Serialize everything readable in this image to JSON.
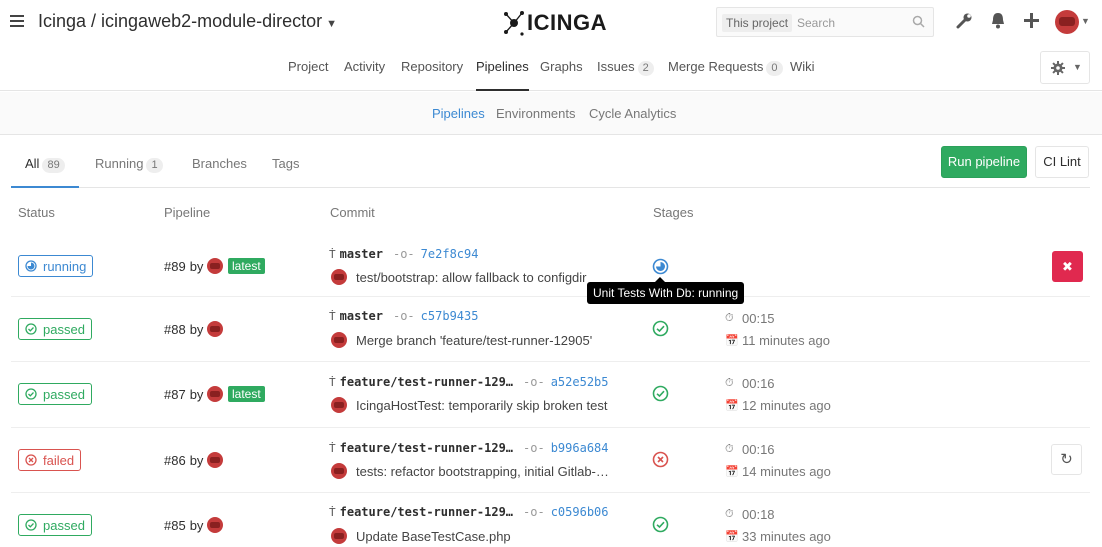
{
  "header": {
    "project_title": "Icinga / icingaweb2-module-director",
    "logo_text": "ICINGA",
    "search_scope": "This project",
    "search_placeholder": "Search"
  },
  "project_nav": [
    {
      "label": "Project"
    },
    {
      "label": "Activity"
    },
    {
      "label": "Repository"
    },
    {
      "label": "Pipelines",
      "active": true
    },
    {
      "label": "Graphs"
    },
    {
      "label": "Issues",
      "count": "2"
    },
    {
      "label": "Merge Requests",
      "count": "0"
    },
    {
      "label": "Wiki"
    }
  ],
  "sub_nav": [
    {
      "label": "Pipelines",
      "active": true
    },
    {
      "label": "Environments"
    },
    {
      "label": "Cycle Analytics"
    }
  ],
  "tabs": [
    {
      "label": "All",
      "count": "89",
      "active": true
    },
    {
      "label": "Running",
      "count": "1"
    },
    {
      "label": "Branches"
    },
    {
      "label": "Tags"
    }
  ],
  "actions": {
    "run_pipeline": "Run pipeline",
    "ci_lint": "CI Lint"
  },
  "table": {
    "headers": [
      "Status",
      "Pipeline",
      "Commit",
      "Stages"
    ],
    "rows": [
      {
        "status": "running",
        "pipeline": "#89",
        "by": "by",
        "latest": "latest",
        "ref": "master",
        "sha": "7e2f8c94",
        "message": "test/bootstrap: allow fallback to configdir",
        "stage": "running",
        "duration": "",
        "finished": "",
        "action": "cancel"
      },
      {
        "status": "passed",
        "pipeline": "#88",
        "by": "by",
        "latest": "",
        "ref": "master",
        "sha": "c57b9435",
        "message": "Merge branch 'feature/test-runner-12905'",
        "stage": "passed",
        "duration": "00:15",
        "finished": "11 minutes ago",
        "action": ""
      },
      {
        "status": "passed",
        "pipeline": "#87",
        "by": "by",
        "latest": "latest",
        "ref": "feature/test-runner-129…",
        "sha": "a52e52b5",
        "message": "IcingaHostTest: temporarily skip broken test",
        "stage": "passed",
        "duration": "00:16",
        "finished": "12 minutes ago",
        "action": ""
      },
      {
        "status": "failed",
        "pipeline": "#86",
        "by": "by",
        "latest": "",
        "ref": "feature/test-runner-129…",
        "sha": "b996a684",
        "message": "tests: refactor bootstrapping, initial Gitlab-…",
        "stage": "failed",
        "duration": "00:16",
        "finished": "14 minutes ago",
        "action": "retry"
      },
      {
        "status": "passed",
        "pipeline": "#85",
        "by": "by",
        "latest": "",
        "ref": "feature/test-runner-129…",
        "sha": "c0596b06",
        "message": "Update BaseTestCase.php",
        "stage": "passed",
        "duration": "00:18",
        "finished": "33 minutes ago",
        "action": ""
      }
    ]
  },
  "tooltip": "Unit Tests With Db: running",
  "colors": {
    "running": "#3c89d2",
    "passed": "#2faa60",
    "failed": "#d9534f",
    "cancel": "#e0294f"
  },
  "icons": {
    "hamburger": "hamburger-icon",
    "wrench": "wrench-icon",
    "bell": "bell-icon",
    "plus": "plus-icon",
    "gear": "gear-icon",
    "search": "search-icon",
    "clock": "timer-icon",
    "calendar": "calendar-icon",
    "branch": "branch-icon",
    "commit": "commit-icon"
  }
}
